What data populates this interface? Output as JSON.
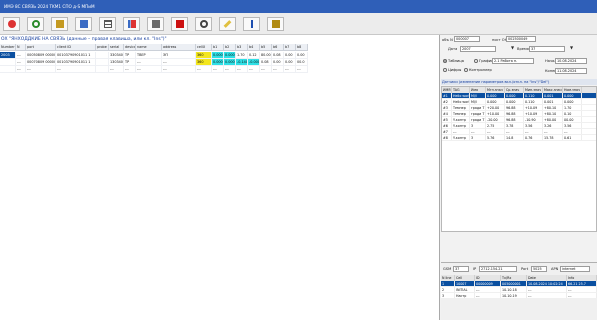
{
  "window": {
    "title": "ИМЭ 8С СВЯЗЬ 2024 TKM1 СПО д-S МПиМ"
  },
  "toolbar": {
    "icons": [
      "save-icon",
      "reload-icon",
      "print-icon",
      "copy-icon",
      "table-icon",
      "chart-icon",
      "list-icon",
      "stop-icon",
      "settings-icon",
      "edit-icon",
      "info-icon",
      "exit-icon"
    ]
  },
  "grid": {
    "title": "ОХ \"ЯНХОДДКИЕ НА СВЯЗЬ (данные – правая клавиша, или кл. \"Ins\")\"",
    "columns": [
      "Number",
      "N",
      "port",
      "client ID",
      "probe",
      "serial",
      "device",
      "name",
      "address",
      "cellX",
      "b1",
      "b2",
      "b3",
      "b4",
      "b5",
      "b6",
      "b7",
      "b8"
    ],
    "rows": [
      [
        "2003",
        "---",
        "00050809 00000000",
        "00103790901011 1",
        "",
        "3303407",
        "TP",
        "ТВЕР",
        "ЭП",
        "360",
        "0.000",
        "0.000",
        "1.70",
        "0.12",
        "80.00",
        "0.08",
        "0.00",
        "0.00"
      ],
      [
        "",
        "---",
        "00070809 00000900",
        "00103790901011 1",
        "",
        "1303401",
        "TP",
        "---",
        "---",
        "360",
        "0.000",
        "0.000",
        "-0.140",
        "-0.000",
        "0.08",
        "0.00",
        "0.00",
        "00.0"
      ],
      [
        "",
        "---",
        "---",
        "---",
        "",
        "---",
        "---",
        "---",
        "---",
        "---",
        "---",
        "---",
        "---",
        "---",
        "---",
        "---",
        "---",
        "---"
      ]
    ]
  },
  "filters": {
    "obj_label": "объ N",
    "obj_value": "000007",
    "pos_label": "пост ОН",
    "pos_value": "002500049",
    "from_label": "Дата",
    "from_value": "2007",
    "to_label": "Время",
    "to_value": "37",
    "r1": "Таблица",
    "r2": "Графики",
    "r3": "Цифры",
    "r4": "Контроллер",
    "mode_value": "2.1 Работа п.",
    "start_label": "Начало",
    "start_value": "10.08.2024",
    "end_label": "Конец",
    "end_value": "11.08.2024"
  },
  "info": {
    "text": "Датчики (изменение параметров вкл./откл. на \"Ins\"/\"Del\")"
  },
  "table2": {
    "columns": [
      "ИМЯ",
      "TAG",
      "Имя",
      "Мгн.знач",
      "Ср.знач",
      "Мин.знач",
      "Макс.знач",
      "Ном.знач"
    ],
    "rows": [
      [
        "#1",
        "Hello world",
        "Ml/l",
        "0.000",
        "0.000",
        "0.110",
        "0.001",
        "0.000"
      ],
      [
        "#2",
        "Hello world",
        "Ml/l",
        "0.000",
        "0.000",
        "0.110",
        "0.001",
        "0.000"
      ],
      [
        "#3",
        "Темпер",
        "гради Т",
        "+20.00",
        "96.88",
        "+10.09",
        "+80.10",
        "1.70"
      ],
      [
        "#4",
        "Темпер",
        "гради Т",
        "+10.00",
        "96.88",
        "+10.09",
        "+80.10",
        "0.10"
      ],
      [
        "#5",
        "Y-контр",
        "гради Т",
        "-20.00",
        "96.88",
        "-10.90",
        "+80.00",
        "00.00"
      ],
      [
        "#6",
        "Y-контр",
        "3",
        "2.75",
        "3.78",
        "3.56",
        "3.26",
        "3.56"
      ],
      [
        "#7",
        "---",
        "---",
        "---",
        "---",
        "---",
        "---",
        "---"
      ],
      [
        "#8",
        "Y-контр",
        "3",
        "5.76",
        "14.8",
        "0.76",
        "15.78",
        "0.61"
      ]
    ]
  },
  "bottom": {
    "c1_label": "GSM",
    "c1_value": "37",
    "c2_label": "IP",
    "c2_value": "2712.154.21",
    "c3_label": "Port",
    "c3_value": "5025",
    "c4_label": "APN",
    "c4_value": "internet",
    "columns": [
      "N line",
      "Cell",
      "ID",
      "Tx/Rx",
      "Date",
      "Info"
    ],
    "rows": [
      [
        "1",
        "10007",
        "00000009",
        "005000001",
        "10.08.2024 10:02:24",
        "66.21 25.7"
      ],
      [
        "2",
        "INITIAL",
        "---",
        "10.10.18",
        "---",
        "---"
      ],
      [
        "3",
        "Настр",
        "---",
        "10.10.19",
        "---",
        "---"
      ]
    ]
  }
}
